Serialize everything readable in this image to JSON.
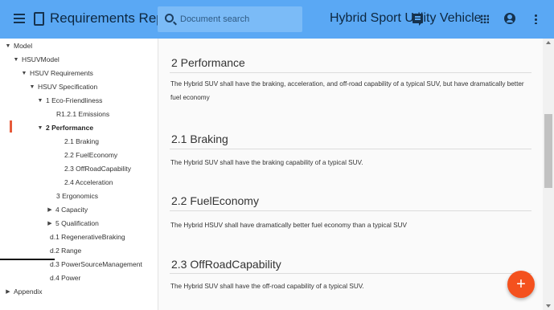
{
  "header": {
    "app_title": "Requirements Report",
    "search_placeholder": "Document search",
    "model_title": "Hybrid Sport Utility Vehicle",
    "icons": [
      "menu-icon",
      "document-icon",
      "search-icon",
      "comment-icon",
      "apps-icon",
      "account-icon",
      "more-vert-icon"
    ]
  },
  "tree": [
    {
      "label": "Model",
      "caret": "▼"
    },
    {
      "label": "HSUVModel",
      "caret": "▼"
    },
    {
      "label": "HSUV Requirements",
      "caret": "▼"
    },
    {
      "label": "HSUV Specification",
      "caret": "▼"
    },
    {
      "label": "1 Eco-Friendliness",
      "caret": "▼"
    },
    {
      "label": "R1.2.1 Emissions",
      "caret": ""
    },
    {
      "label": "2 Performance",
      "caret": "▼"
    },
    {
      "label": "2.1 Braking",
      "caret": ""
    },
    {
      "label": "2.2 FuelEconomy",
      "caret": ""
    },
    {
      "label": "2.3 OffRoadCapability",
      "caret": ""
    },
    {
      "label": "2.4 Acceleration",
      "caret": ""
    },
    {
      "label": "3 Ergonomics",
      "caret": ""
    },
    {
      "label": "4 Capacity",
      "caret": "▶"
    },
    {
      "label": "5 Qualification",
      "caret": "▶"
    },
    {
      "label": "d.1 RegenerativeBraking",
      "caret": ""
    },
    {
      "label": "d.2 Range",
      "caret": ""
    },
    {
      "label": "d.3 PowerSourceManagement",
      "caret": ""
    },
    {
      "label": "d.4 Power",
      "caret": ""
    },
    {
      "label": "Appendix",
      "caret": "▶"
    }
  ],
  "sections": [
    {
      "heading": "2 Performance",
      "body": "The Hybrid SUV shall have the braking, acceleration, and off-road capability of a typical SUV, but have dramatically better fuel economy"
    },
    {
      "heading": "2.1 Braking",
      "body": "The Hybrid SUV shall have the braking capability of a typical SUV."
    },
    {
      "heading": "2.2 FuelEconomy",
      "body": "The Hybrid HSUV shall have dramatically better fuel economy than a typical SUV"
    },
    {
      "heading": "2.3 OffRoadCapability",
      "body": "The Hybrid SUV shall have the off-road capability of a typical SUV."
    }
  ],
  "fab": {
    "label": "+"
  },
  "colors": {
    "appbar": "#5aa8f4",
    "fab": "#f4511e",
    "active_marker": "#e65a3a"
  }
}
